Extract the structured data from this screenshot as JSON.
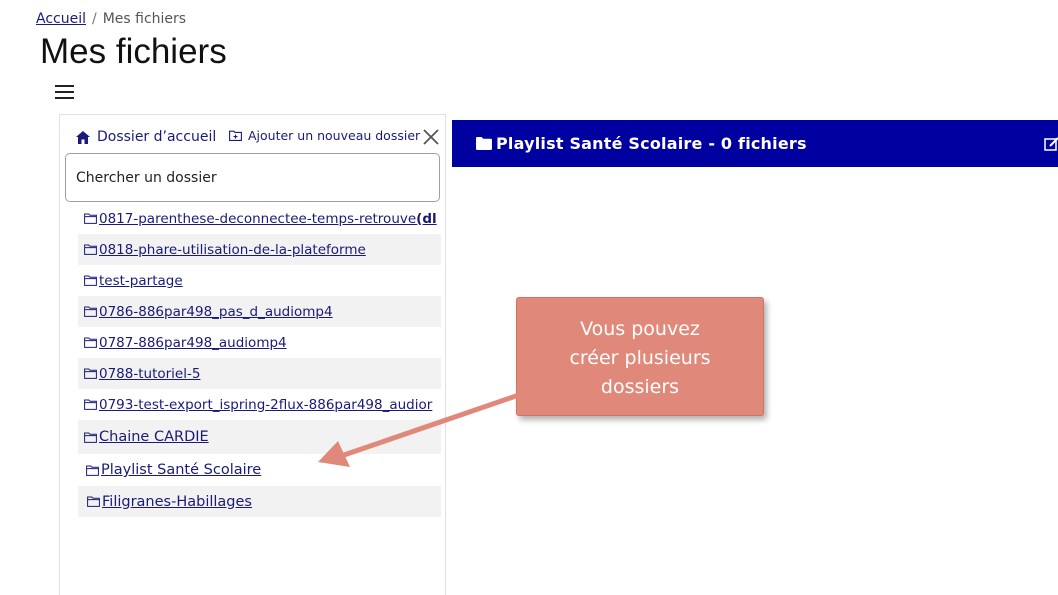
{
  "breadcrumb": {
    "home": "Accueil",
    "separator": "/",
    "current": "Mes fichiers"
  },
  "page": {
    "title": "Mes fichiers"
  },
  "menu": {
    "icon": "hamburger-icon"
  },
  "left_panel": {
    "home_label": "Dossier d’accueil",
    "add_folder_label": "Ajouter un nouveau dossier",
    "search_placeholder": "Chercher un dossier",
    "folders": [
      {
        "name": "0817-parenthese-deconnectee-temps-retrouve",
        "suffix": "(dl"
      },
      {
        "name": "0818-phare-utilisation-de-la-plateforme"
      },
      {
        "name": "test-partage"
      },
      {
        "name": "0786-886par498_pas_d_audiomp4"
      },
      {
        "name": "0787-886par498_audiomp4"
      },
      {
        "name": "0788-tutoriel-5"
      },
      {
        "name": "0793-test-export_ispring-2flux-886par498_audior"
      },
      {
        "name": "Chaine CARDIE"
      },
      {
        "name": "Playlist Santé Scolaire"
      },
      {
        "name": "Filigranes-Habillages"
      }
    ]
  },
  "right_panel": {
    "header_title": "Playlist Santé Scolaire - 0 fichiers"
  },
  "callout": {
    "line1": "Vous pouvez",
    "line2": "créer plusieurs",
    "line3": "dossiers"
  },
  "colors": {
    "header_bg": "#0000a0",
    "link": "#1a1a7a",
    "callout_bg": "#e0897a",
    "row_alt": "#f2f2f2"
  }
}
